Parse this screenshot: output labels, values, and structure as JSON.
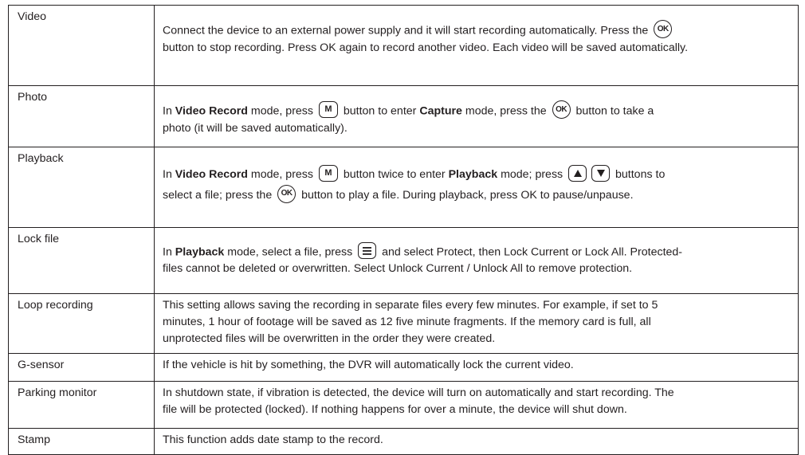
{
  "rows": [
    {
      "feature": "Video",
      "lines": [
        {
          "segments": [
            {
              "t": "Connect the device to an external power supply and it will start recording automatically. Press the "
            },
            {
              "key": "OK"
            }
          ]
        },
        {
          "segments": [
            {
              "t": "button to stop recording. Press OK again to record another video. Each video will be saved automatically."
            }
          ]
        }
      ]
    },
    {
      "feature": "Photo",
      "lines": [
        {
          "segments": [
            {
              "t": "In "
            },
            {
              "b": "Video Record"
            },
            {
              "t": " mode, press "
            },
            {
              "key": "M"
            },
            {
              "t": " button to enter "
            },
            {
              "b": "Capture"
            },
            {
              "t": " mode, press the "
            },
            {
              "key": "OK"
            },
            {
              "t": " button to take a"
            }
          ]
        },
        {
          "segments": [
            {
              "t": "photo (it will be saved automatically)."
            }
          ]
        }
      ]
    },
    {
      "feature": "Playback",
      "lines": [
        {
          "segments": [
            {
              "t": "In "
            },
            {
              "b": "Video Record"
            },
            {
              "t": " mode, press "
            },
            {
              "key": "M"
            },
            {
              "t": " button twice to enter "
            },
            {
              "b": "Playback"
            },
            {
              "t": " mode; press "
            },
            {
              "key": "up-arrow"
            },
            {
              "key": "down-arrow"
            },
            {
              "t": " buttons to"
            }
          ]
        },
        {
          "segments": [
            {
              "t": "select a file; press the "
            },
            {
              "key": "OK"
            },
            {
              "t": " button to play a file. During playback, press OK to pause/unpause."
            }
          ]
        }
      ]
    },
    {
      "feature": "Lock file",
      "lines": [
        {
          "segments": [
            {
              "t": "In "
            },
            {
              "b": "Playback"
            },
            {
              "t": " mode, select a file, press "
            },
            {
              "key": "menu"
            },
            {
              "t": " and select Protect, then Lock Current or Lock All. Protected-"
            }
          ]
        },
        {
          "segments": [
            {
              "t": "files cannot be deleted or overwritten. Select Unlock Current / Unlock All to remove protection."
            }
          ]
        }
      ]
    },
    {
      "feature": "Loop recording",
      "lines": [
        {
          "segments": [
            {
              "t": "This setting allows saving the recording in separate files every few minutes. For example, if set to 5"
            }
          ]
        },
        {
          "segments": [
            {
              "t": "minutes, 1 hour of footage will be saved as 12 five minute fragments. If the memory card is full, all"
            }
          ]
        },
        {
          "segments": [
            {
              "t": "unprotected files will be overwritten in the order they were created."
            }
          ]
        }
      ]
    },
    {
      "feature": "G-sensor",
      "lines": [
        {
          "segments": [
            {
              "t": "If the vehicle is hit by something, the DVR will automatically lock the current video."
            }
          ]
        }
      ]
    },
    {
      "feature": "Parking monitor",
      "lines": [
        {
          "segments": [
            {
              "t": "In shutdown state, if vibration is detected, the device will turn on automatically and start recording. The"
            }
          ]
        },
        {
          "segments": [
            {
              "t": "file will be protected (locked). If nothing happens for over a minute, the device will shut down."
            }
          ]
        }
      ]
    },
    {
      "feature": "Stamp",
      "lines": [
        {
          "segments": [
            {
              "t": "This function adds date stamp to the record."
            }
          ]
        }
      ]
    }
  ],
  "key_labels": {
    "OK": "OK",
    "M": "M"
  }
}
